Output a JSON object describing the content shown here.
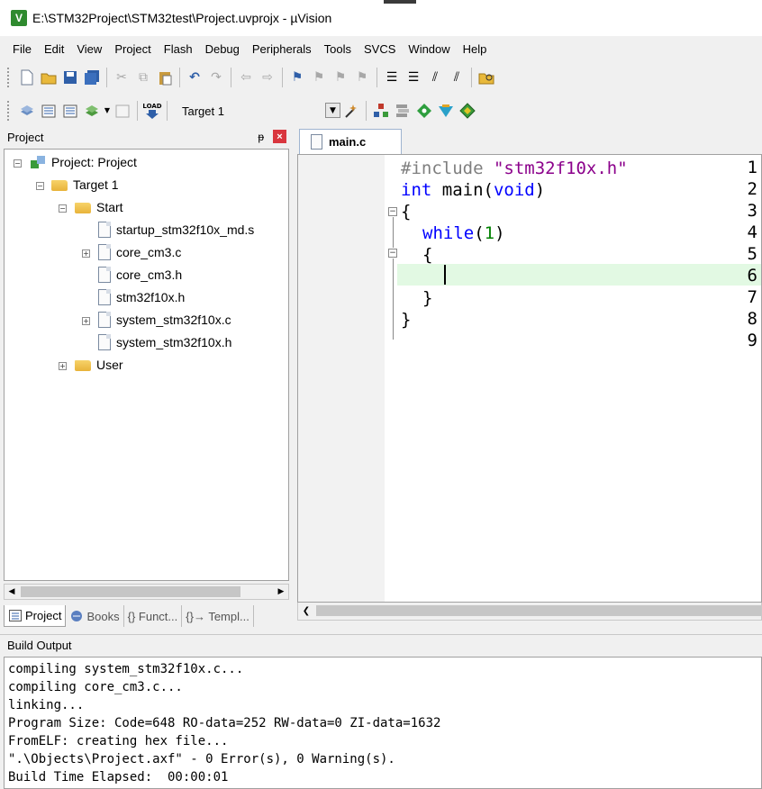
{
  "window": {
    "title": "E:\\STM32Project\\STM32test\\Project.uvprojx - µVision",
    "app_icon_letter": "V"
  },
  "menu": [
    "File",
    "Edit",
    "View",
    "Project",
    "Flash",
    "Debug",
    "Peripherals",
    "Tools",
    "SVCS",
    "Window",
    "Help"
  ],
  "toolbar2": {
    "target_selected": "Target 1",
    "load_label": "LOAD"
  },
  "project_panel": {
    "title": "Project",
    "pin_glyph": "ᵽ",
    "close_glyph": "×",
    "tree": {
      "root": "Project: Project",
      "target": "Target 1",
      "group_start": "Start",
      "files": [
        "startup_stm32f10x_md.s",
        "core_cm3.c",
        "core_cm3.h",
        "stm32f10x.h",
        "system_stm32f10x.c",
        "system_stm32f10x.h"
      ],
      "group_user": "User"
    },
    "tabs": [
      "Project",
      "Books",
      "{} Funct...",
      "{}→ Templ..."
    ]
  },
  "editor": {
    "tab_label": "main.c",
    "line_numbers": [
      "1",
      "2",
      "3",
      "4",
      "5",
      "6",
      "7",
      "8",
      "9"
    ],
    "lines": {
      "l1_directive": "#include",
      "l1_string": "\"stm32f10x.h\"",
      "l2_type": "int",
      "l2_name": " main(",
      "l2_void": "void",
      "l2_close": ")",
      "l3": "{",
      "l4_kw": "while",
      "l4_open": "(",
      "l4_num": "1",
      "l4_close": ")",
      "l5": "{",
      "l7": "}",
      "l8": "}"
    }
  },
  "build_output": {
    "title": "Build Output",
    "lines": [
      "compiling system_stm32f10x.c...",
      "compiling core_cm3.c...",
      "linking...",
      "Program Size: Code=648 RO-data=252 RW-data=0 ZI-data=1632",
      "FromELF: creating hex file...",
      "\".\\Objects\\Project.axf\" - 0 Error(s), 0 Warning(s).",
      "Build Time Elapsed:  00:00:01"
    ]
  },
  "colors": {
    "highlight_line": "#e2f9e3",
    "keyword": "#0000ff",
    "string": "#8b008b",
    "preprocessor": "#7f7f7f",
    "number": "#008000"
  }
}
